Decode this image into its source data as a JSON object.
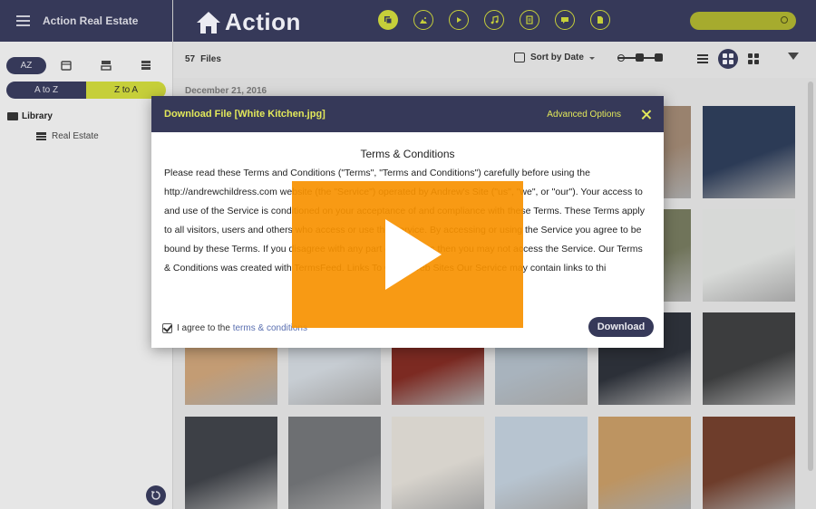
{
  "sidebar": {
    "title": "Action Real Estate",
    "az_label": "AZ",
    "sort_toggle": {
      "left": "A to Z",
      "right": "Z to A"
    },
    "tree": {
      "root": "Library",
      "child": "Real Estate"
    }
  },
  "header": {
    "logo_text": "Action",
    "media_icons": [
      "layers-icon",
      "image-icon",
      "video-icon",
      "music-icon",
      "document-icon",
      "chat-icon",
      "file-icon"
    ]
  },
  "toolbar": {
    "file_count": "57",
    "files_label": "Files",
    "sort_label": "Sort by Date"
  },
  "gallery": {
    "date_header": "December 21, 2016",
    "thumbnail_colors": {
      "r1": [
        "#8e9aa3",
        "#c9c4ba",
        "#6a5a4a",
        "#a79d90",
        "#99826e",
        "#2c3b56"
      ],
      "r2": [
        "#b5b7b5",
        "#d3d5d4",
        "#7b7d7a",
        "#a9aba5",
        "#70745a",
        "#d7d9d7"
      ],
      "r3": [
        "#c39c74",
        "#c7cdd3",
        "#7c2a22",
        "#a8b3bd",
        "#2c3038",
        "#3c3d3e"
      ],
      "r4": [
        "#3d4046",
        "#6d6f72",
        "#d7d3cc",
        "#b7c4d0",
        "#bd9461",
        "#6e3d2b"
      ]
    }
  },
  "modal": {
    "title": "Download File [White Kitchen.jpg]",
    "advanced_label": "Advanced Options",
    "terms_title": "Terms & Conditions",
    "terms_text": "Please read these Terms and Conditions (\"Terms\", \"Terms and Conditions\") carefully before using the http://andrewchildress.com website (the \"Service\") operated by Andrew's Site (\"us\", \"we\", or \"our\"). Your access to and use of the Service is conditioned on your acceptance of and compliance with these Terms. These Terms apply to all visitors, users and others who access or use the Service. By accessing or using the Service you agree to be bound by these Terms. If you disagree with any part of the terms then you may not access the Service. Our Terms & Conditions was created with TermsFeed. Links To Other Web Sites Our Service may contain links to thi",
    "agree_prefix": "I agree to the",
    "agree_link": "terms & conditions",
    "download_label": "Download"
  },
  "overlay": {
    "icon": "play-icon",
    "color": "#f79100"
  },
  "colors": {
    "brand_dark": "#363959",
    "accent_yellow": "#c6cf3a"
  }
}
